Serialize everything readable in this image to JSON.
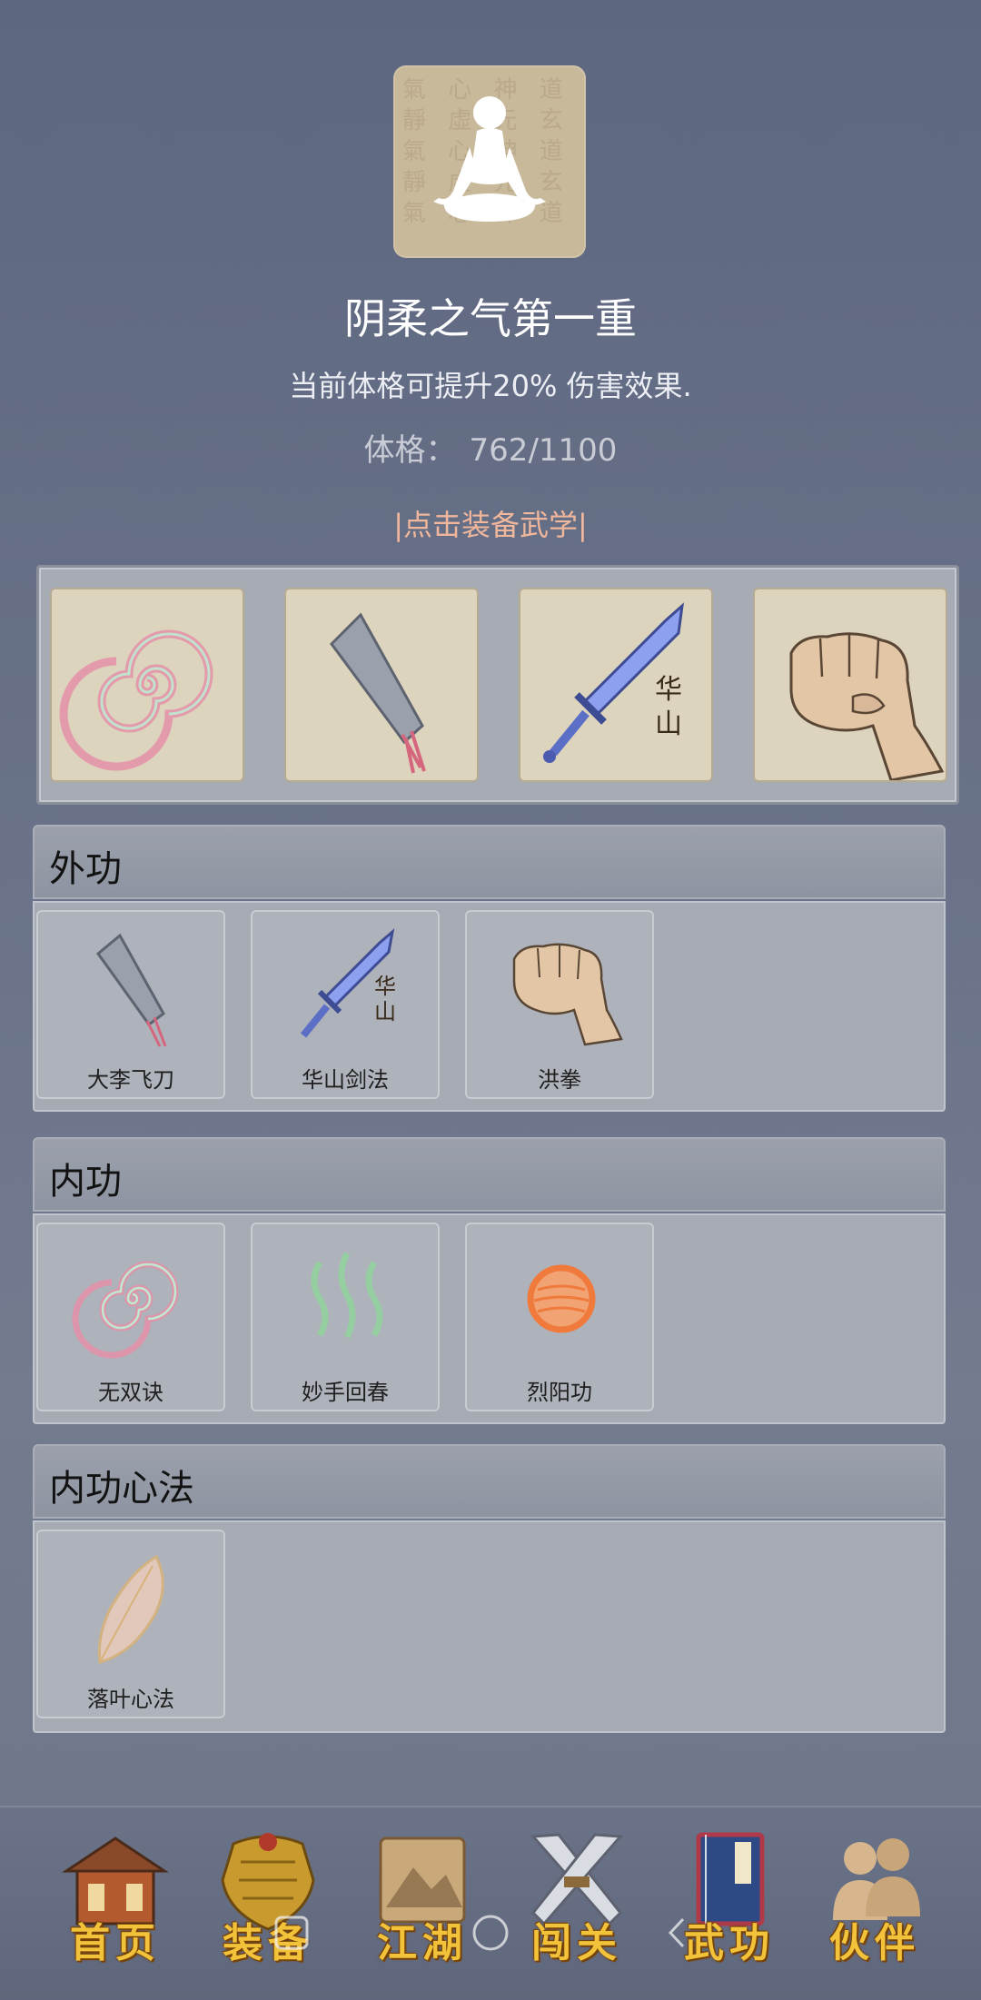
{
  "header": {
    "title": "阴柔之气第一重",
    "description": "当前体格可提升20% 伤害效果.",
    "stat_label": "体格：",
    "stat_value": "762/1100",
    "equip_link": "点击装备武学"
  },
  "equipped_slots": [
    {
      "icon": "swirl-icon"
    },
    {
      "icon": "cleaver-icon"
    },
    {
      "icon": "sword-icon",
      "mark": "华山"
    },
    {
      "icon": "fist-icon"
    }
  ],
  "sections": {
    "waigong": {
      "title": "外功",
      "skills": [
        {
          "label": "大李飞刀",
          "icon": "cleaver-icon"
        },
        {
          "label": "华山剑法",
          "icon": "sword-icon",
          "mark": "华山"
        },
        {
          "label": "洪拳",
          "icon": "fist-icon"
        }
      ]
    },
    "neigong": {
      "title": "内功",
      "skills": [
        {
          "label": "无双诀",
          "icon": "swirl-icon"
        },
        {
          "label": "妙手回春",
          "icon": "steam-icon"
        },
        {
          "label": "烈阳功",
          "icon": "sun-orb-icon"
        }
      ]
    },
    "xinfa": {
      "title": "内功心法",
      "skills": [
        {
          "label": "落叶心法",
          "icon": "leaf-icon"
        }
      ]
    }
  },
  "nav": [
    {
      "label": "首页",
      "icon": "house-icon"
    },
    {
      "label": "装备",
      "icon": "armor-icon"
    },
    {
      "label": "江湖",
      "icon": "scroll-map-icon"
    },
    {
      "label": "闯关",
      "icon": "crossed-swords-icon"
    },
    {
      "label": "武功",
      "icon": "book-icon"
    },
    {
      "label": "伙伴",
      "icon": "companions-icon"
    }
  ],
  "colors": {
    "background": "#666f86",
    "nav_text": "#f2c23a",
    "equip_link": "#f0b79c"
  }
}
